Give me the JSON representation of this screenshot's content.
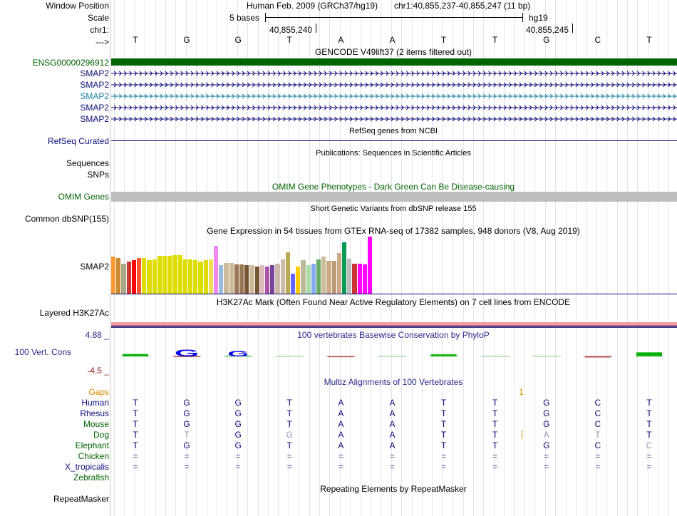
{
  "header": {
    "window_position_label": "Window Position",
    "scale_label": "Scale",
    "chrom_label": "chr1:",
    "arrow_label": "--->",
    "assembly_text": "Human Feb. 2009 (GRCh37/hg19)",
    "position_text": "chr1:40,855,237-40,855,247 (11 bp)",
    "scale_text": "5 bases",
    "scale_db": "hg19",
    "coord_1": "40,855,240",
    "coord_2": "40,855,245"
  },
  "bases": [
    "T",
    "G",
    "G",
    "T",
    "A",
    "A",
    "T",
    "T",
    "G",
    "C",
    "T"
  ],
  "tracks": {
    "gencode": {
      "title": "GENCODE V49lift37 (2 items filtered out)",
      "gene_label": "ENSG00000296912",
      "gene_color": "#006400",
      "transcripts": [
        {
          "label": "SMAP2",
          "color": "#0c0c78"
        },
        {
          "label": "SMAP2",
          "color": "#0c0c78"
        },
        {
          "label": "SMAP2",
          "color": "#1a82a0"
        },
        {
          "label": "SMAP2",
          "color": "#0c0c78"
        },
        {
          "label": "SMAP2",
          "color": "#0c0c78"
        }
      ]
    },
    "refseq": {
      "title": "RefSeq genes from NCBI",
      "label": "RefSeq Curated",
      "color": "#0c0c78"
    },
    "publications": {
      "title": "Publications: Sequences in Scientific Articles",
      "label": "Sequences"
    },
    "snps_label": "SNPs",
    "omim": {
      "title": "OMIM Gene Phenotypes - Dark Green Can Be Disease-causing",
      "label": "OMIM Genes",
      "color": "#006400"
    },
    "dbsnp": {
      "title": "Short Genetic Variants from dbSNP release 155",
      "label": "Common dbSNP(155)"
    },
    "gtex": {
      "title": "Gene Expression in 54 tissues from GTEx RNA-seq of 17382 samples, 948 donors (V8, Aug 2019)",
      "label": "SMAP2"
    },
    "h3k27ac": {
      "title": "H3K27Ac Mark (Often Found Near Active Regulatory Elements) on 7 cell lines from ENCODE",
      "label": "Layered H3K27Ac"
    },
    "phylop": {
      "title": "100 vertebrates Basewise Conservation by PhyloP",
      "label": "100 Vert. Cons",
      "max": "4.88 _",
      "min": "-4.5 _",
      "color": "#2a2a8a"
    },
    "multiz": {
      "title": "Multiz Alignments of 100 Vertebrates",
      "gaps_label": "Gaps",
      "gaps_value": "1",
      "gaps_color": "#d98c00",
      "title_color": "#2a2a8a"
    },
    "repeatmasker": {
      "title": "Repeating Elements by RepeatMasker",
      "label": "RepeatMasker"
    }
  },
  "species": [
    {
      "name": "Human",
      "color": "#0c0c78",
      "bases": [
        "T",
        "G",
        "G",
        "T",
        "A",
        "A",
        "T",
        "T",
        "G",
        "C",
        "T"
      ]
    },
    {
      "name": "Rhesus",
      "color": "#0c0c78",
      "bases": [
        "T",
        "G",
        "G",
        "T",
        "A",
        "A",
        "T",
        "T",
        "G",
        "C",
        "T"
      ]
    },
    {
      "name": "Mouse",
      "color": "#006400",
      "bases": [
        "T",
        "G",
        "G",
        "T",
        "A",
        "A",
        "T",
        "T",
        "G",
        "C",
        "T"
      ]
    },
    {
      "name": "Dog",
      "color": "#006400",
      "bases": [
        "T",
        "T",
        "G",
        "G",
        "A",
        "A",
        "T",
        "T",
        "A",
        "T",
        "T"
      ]
    },
    {
      "name": "Elephant",
      "color": "#006400",
      "bases": [
        "T",
        "G",
        "G",
        "T",
        "A",
        "A",
        "T",
        "T",
        "G",
        "C",
        "C"
      ]
    },
    {
      "name": "Chicken",
      "color": "#006400",
      "bases": [
        "=",
        "=",
        "=",
        "=",
        "=",
        "=",
        "=",
        "=",
        "=",
        "=",
        "="
      ]
    },
    {
      "name": "X_tropicalis",
      "color": "#0c0c78",
      "bases": [
        "=",
        "=",
        "=",
        "=",
        "=",
        "=",
        "=",
        "=",
        "=",
        "=",
        "="
      ]
    },
    {
      "name": "Zebrafish",
      "color": "#006400",
      "bases": []
    }
  ],
  "dog_mismatch_cols": [
    1,
    3,
    8,
    9
  ],
  "elephant_mismatch_cols": [
    10
  ],
  "gtex_bars": {
    "values": [
      52,
      50,
      42,
      45,
      47,
      50,
      50,
      47,
      48,
      53,
      53,
      53,
      54,
      54,
      48,
      48,
      47,
      45,
      47,
      48,
      67,
      40,
      43,
      43,
      41,
      41,
      40,
      40,
      38,
      40,
      38,
      40,
      42,
      48,
      58,
      28,
      38,
      47,
      40,
      42,
      48,
      52,
      46,
      46,
      57,
      72,
      49,
      42,
      42,
      41,
      80
    ],
    "colors": [
      "#ff9933",
      "#cc8833",
      "#aaaa88",
      "#cc3333",
      "#ff0000",
      "#ff5533",
      "#dddd00",
      "#dddd00",
      "#dddd00",
      "#dddd00",
      "#dddd00",
      "#dddd00",
      "#dddd00",
      "#dddd00",
      "#dddd00",
      "#dddd00",
      "#dddd00",
      "#dddd00",
      "#dddd00",
      "#eedd55",
      "#ee88ee",
      "#99bbdd",
      "#ccbb99",
      "#ccbb99",
      "#997755",
      "#997755",
      "#775533",
      "#ccbb99",
      "#775533",
      "#ddbbbb",
      "#aa55aa",
      "#774499",
      "#ccbbaa",
      "#ccbbaa",
      "#bbaa55",
      "#6666ff",
      "#ffcc00",
      "#bbbb99",
      "#aaddaa",
      "#88aaee",
      "#66aa66",
      "#ccbb99",
      "#ccaa88",
      "#bb9977",
      "#ccaa88",
      "#009955",
      "#bbbbbb",
      "#cc3333",
      "#ff00ff",
      "#ff00ff",
      "#ff00ff"
    ]
  },
  "phylop_marks": [
    {
      "pos": 0,
      "v": 0.4
    },
    {
      "pos": 1,
      "v": -0.1
    },
    {
      "pos": 2,
      "v": 0.02
    },
    {
      "pos": 3,
      "v": 0.0
    },
    {
      "pos": 4,
      "v": -0.15
    },
    {
      "pos": 5,
      "v": 0.0
    },
    {
      "pos": 6,
      "v": 0.35
    },
    {
      "pos": 7,
      "v": 0.0
    },
    {
      "pos": 8,
      "v": 0.0
    },
    {
      "pos": 9,
      "v": -0.2
    },
    {
      "pos": 10,
      "v": 0.7
    }
  ]
}
